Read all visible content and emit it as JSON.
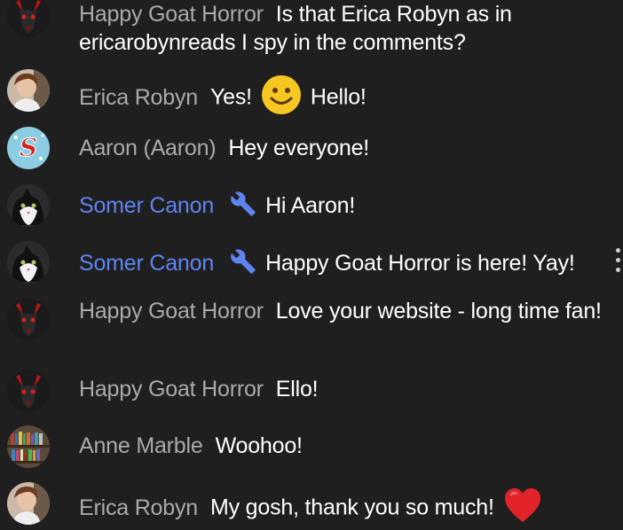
{
  "messages": [
    {
      "author": "Happy Goat Horror",
      "text": "Is that Erica Robyn as in ericarobynreads I spy in the comments?"
    },
    {
      "author": "Erica Robyn",
      "text_before": "Yes!",
      "text_after": "Hello!",
      "emoji": "smiling-face-emoji"
    },
    {
      "author": "Aaron (Aaron)",
      "text": "Hey everyone!"
    },
    {
      "author": "Somer Canon",
      "text": "Hi Aaron!",
      "badge": "wrench-icon"
    },
    {
      "author": "Somer Canon",
      "text": "Happy Goat Horror is here! Yay!",
      "badge": "wrench-icon"
    },
    {
      "author": "Happy Goat Horror",
      "text": "Love your website - long time fan!"
    },
    {
      "author": "Happy Goat Horror",
      "text": "Ello!"
    },
    {
      "author": "Anne Marble",
      "text": "Woohoo!"
    },
    {
      "author": "Erica Robyn",
      "text": "My gosh, thank you so much!",
      "emoji": "red-heart-emoji"
    }
  ],
  "colors": {
    "background": "#1f1f1f",
    "author": "#aaaaaa",
    "moderator": "#5e84f1",
    "text": "#ffffff"
  }
}
